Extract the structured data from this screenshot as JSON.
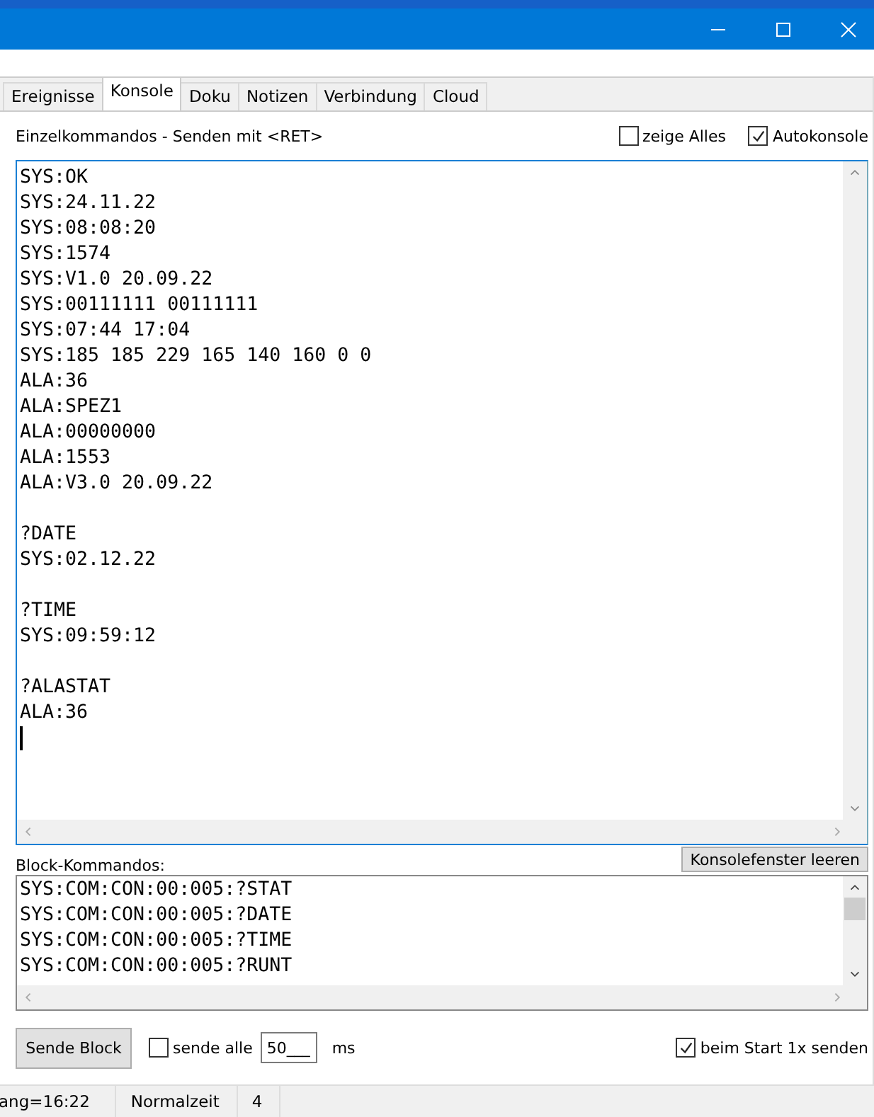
{
  "tabs": [
    {
      "label": "Ereignisse",
      "selected": false
    },
    {
      "label": "Konsole",
      "selected": true
    },
    {
      "label": "Doku",
      "selected": false
    },
    {
      "label": "Notizen",
      "selected": false
    },
    {
      "label": "Verbindung",
      "selected": false
    },
    {
      "label": "Cloud",
      "selected": false
    }
  ],
  "console_header": {
    "label": "Einzelkommandos - Senden mit <RET>",
    "options": [
      {
        "label": "zeige Alles",
        "checked": false
      },
      {
        "label": "Autokonsole",
        "checked": true
      }
    ]
  },
  "console": {
    "groups": [
      {
        "lines": [
          "SYS:OK",
          "SYS:24.11.22",
          "SYS:08:08:20",
          "SYS:1574",
          "SYS:V1.0 20.09.22",
          "SYS:00111111 00111111",
          "SYS:07:44 17:04",
          "SYS:185 185 229 165 140 160 0 0",
          "ALA:36",
          "ALA:SPEZ1",
          "ALA:00000000",
          "ALA:1553",
          "ALA:V3.0 20.09.22"
        ]
      },
      {
        "lines": [
          "?DATE",
          "SYS:02.12.22"
        ]
      },
      {
        "lines": [
          "?TIME",
          "SYS:09:59:12"
        ]
      },
      {
        "cursor": true,
        "lines": [
          "?ALASTAT",
          "ALA:36"
        ]
      }
    ]
  },
  "clear_button": "Konsolefenster leeren",
  "block": {
    "label": "Block-Kommandos:",
    "lines": [
      "SYS:COM:CON:00:005:?STAT",
      "SYS:COM:CON:00:005:?DATE",
      "SYS:COM:CON:00:005:?TIME",
      "SYS:COM:CON:00:005:?RUNT"
    ]
  },
  "bottom": {
    "send_button": "Sende Block",
    "repeat": {
      "label": "sende alle",
      "checked": false
    },
    "interval": "50___",
    "unit": "ms",
    "startup": {
      "label": "beim Start 1x senden",
      "checked": true
    }
  },
  "status_bar": [
    "ang=16:22",
    "Normalzeit",
    "4"
  ]
}
